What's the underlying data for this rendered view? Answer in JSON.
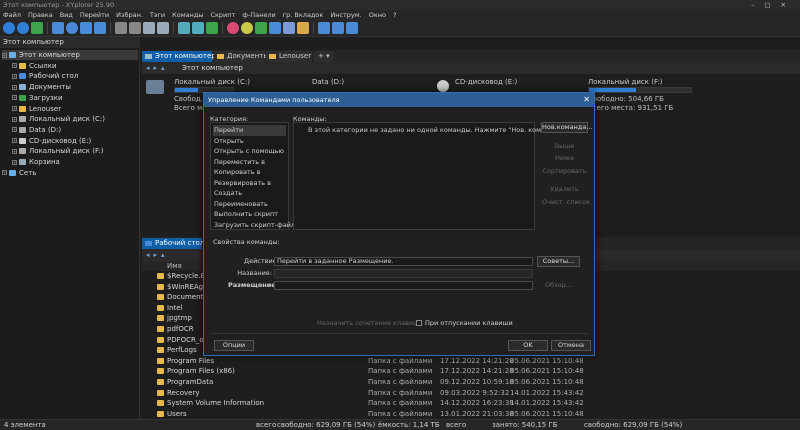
{
  "window": {
    "title": "Этот компьютер - XYplorer 25.90"
  },
  "menu": [
    "Файл",
    "Правка",
    "Вид",
    "Перейти",
    "Избран.",
    "Тэги",
    "Команды",
    "Скрипт",
    "ф-Панели",
    "гр. Вкладок",
    "Инструм.",
    "Окно",
    "?"
  ],
  "tree": {
    "header": "Этот компьютер",
    "items": [
      {
        "label": "Этот компьютер",
        "level": 0,
        "selected": true,
        "icon": "computer-icon"
      },
      {
        "label": "Ссылки",
        "level": 1,
        "icon": "folder-icon"
      },
      {
        "label": "Рабочий стол",
        "level": 1,
        "icon": "desktop-icon"
      },
      {
        "label": "Документы",
        "level": 1,
        "icon": "documents-icon"
      },
      {
        "label": "Загрузки",
        "level": 1,
        "icon": "downloads-icon"
      },
      {
        "label": "Lenouser",
        "level": 1,
        "icon": "user-folder-icon"
      },
      {
        "label": "Локальный диск (C:)",
        "level": 1,
        "icon": "drive-icon"
      },
      {
        "label": "Data (D:)",
        "level": 1,
        "icon": "drive-icon"
      },
      {
        "label": "CD-дисковод (E:)",
        "level": 1,
        "icon": "cd-icon"
      },
      {
        "label": "Локальный диск (F:)",
        "level": 1,
        "icon": "drive-icon"
      },
      {
        "label": "Корзина",
        "level": 1,
        "icon": "recycle-bin-icon"
      },
      {
        "label": "Сеть",
        "level": 0,
        "icon": "network-icon"
      }
    ]
  },
  "upper_pane": {
    "tabs": [
      "Этот компьютер",
      "Документы",
      "Lenouser"
    ],
    "address": "Этот компьютер",
    "drives": [
      {
        "name": "Локальный диск (C:)",
        "line1": "Свобод...",
        "line2": "Всего мест...",
        "used_fraction": 0.4
      },
      {
        "name": "Data (D:)",
        "line1": "",
        "line2": "",
        "used_fraction": 0.0
      },
      {
        "name": "CD-дисковод (E:)",
        "line1": "",
        "line2": "",
        "used_fraction": 0.0
      },
      {
        "name": "Локальный диск (F:)",
        "line1": "Свободно: 504,66 ГБ",
        "line2": "Всего места: 931,51 ГБ",
        "used_fraction": 0.46
      }
    ]
  },
  "lower_pane": {
    "tab": "Рабочий стол",
    "column_name": "Имя",
    "files": [
      {
        "name": "$Recycle.Bin",
        "type": "",
        "d1": "",
        "d2": ""
      },
      {
        "name": "$WinREAgent",
        "type": "",
        "d1": "",
        "d2": ""
      },
      {
        "name": "Documents and",
        "type": "",
        "d1": "",
        "d2": ""
      },
      {
        "name": "Intel",
        "type": "",
        "d1": "",
        "d2": ""
      },
      {
        "name": "jpgtmp",
        "type": "",
        "d1": "",
        "d2": ""
      },
      {
        "name": "pdfOCR",
        "type": "",
        "d1": "",
        "d2": ""
      },
      {
        "name": "PDFOCR_outpu",
        "type": "",
        "d1": "",
        "d2": ""
      },
      {
        "name": "PerfLogs",
        "type": "",
        "d1": "",
        "d2": ""
      },
      {
        "name": "Program Files",
        "type": "Папка с файлами",
        "d1": "17.12.2022 14:21:28",
        "d2": "05.06.2021 15:10:48"
      },
      {
        "name": "Program Files (x86)",
        "type": "Папка с файлами",
        "d1": "17.12.2022 14:21:28",
        "d2": "05.06.2021 15:10:48"
      },
      {
        "name": "ProgramData",
        "type": "Папка с файлами",
        "d1": "09.12.2022 10:59:18",
        "d2": "05.06.2021 15:10:48"
      },
      {
        "name": "Recovery",
        "type": "Папка с файлами",
        "d1": "09.03.2022 9:52:32",
        "d2": "14.01.2022 15:43:42"
      },
      {
        "name": "System Volume Information",
        "type": "Папка с файлами",
        "d1": "14.12.2022 16:23:38",
        "d2": "14.01.2022 15:43:42"
      },
      {
        "name": "Users",
        "type": "Папка с файлами",
        "d1": "13.01.2022 21:03:38",
        "d2": "05.06.2021 15:10:48"
      }
    ]
  },
  "status": {
    "count": "4 элемента",
    "total": "всего",
    "free": "свободно: 629,09 ГБ (54%)",
    "capacity": "ёмкость: 1,14 ТБ",
    "free2": "всего",
    "used": "занято: 540,15 ГБ",
    "free3": "свободно: 629,09 ГБ (54%)"
  },
  "dialog": {
    "title": "Управление Командами пользователя",
    "categories_label": "Категория:",
    "categories": [
      "Перейти",
      "Открыть",
      "Открыть с помощью",
      "Переместить в",
      "Копировать в",
      "Резервировать в",
      "Создать",
      "Переименовать",
      "Выполнить скрипт",
      "Загрузить скрипт-файл"
    ],
    "commands_label": "Команды:",
    "empty_message": "В этой категории не задано ни одной команды. Нажмите \"Нов. команда...\"",
    "buttons_right": {
      "new": "Нов.команда...",
      "up": "Выше",
      "down": "Ниже",
      "sort": "Сортировать",
      "delete": "Удалить",
      "clear": "Очист. список"
    },
    "props_label": "Свойства команды:",
    "action_label": "Действие:",
    "action_value": "Перейти в заданное Размещение.",
    "settings_button": "Советы...",
    "name_label": "Название:",
    "name_value": "",
    "location_label": "Размещение:",
    "location_value": "",
    "browse_button": "Обзор...",
    "hotkey_button": "Назначить сочетание клавиш...",
    "shift_checkbox": "При отпускании клавиши",
    "options_button": "Опции",
    "ok_button": "OK",
    "cancel_button": "Отмена"
  },
  "colors": {
    "accent": "#2f7fd6",
    "dialog_title": "#2d5f95",
    "folder": "#e8b84a"
  }
}
